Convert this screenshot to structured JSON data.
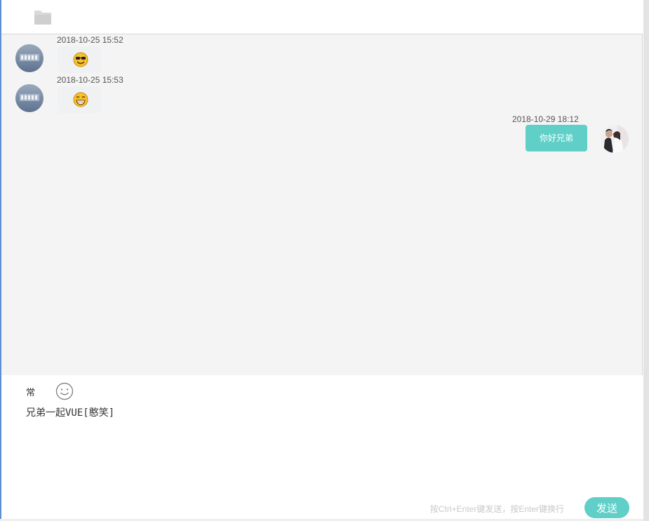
{
  "header": {
    "folder_icon": "folder-icon"
  },
  "messages": [
    {
      "sender": "other",
      "timestamp": "2018-10-25 15:52",
      "content_type": "emoji",
      "emoji": "cool-sunglasses-emoji"
    },
    {
      "sender": "other",
      "timestamp": "2018-10-25 15:53",
      "content_type": "emoji",
      "emoji": "grin-emoji"
    },
    {
      "sender": "self",
      "timestamp": "2018-10-29 18:12",
      "content_type": "text",
      "text": "你好兄弟"
    }
  ],
  "toolbar": {
    "frequent_label": "常",
    "emoji_icon": "smile-icon"
  },
  "input": {
    "value": "兄弟一起VUE[憨笑]"
  },
  "footer": {
    "hint": "按Ctrl+Enter键发送，按Enter键换行",
    "send_label": "发送"
  },
  "colors": {
    "accent": "#5fcfc8",
    "chat_bg": "#f4f4f5",
    "left_edge": "#5f8ed2"
  }
}
